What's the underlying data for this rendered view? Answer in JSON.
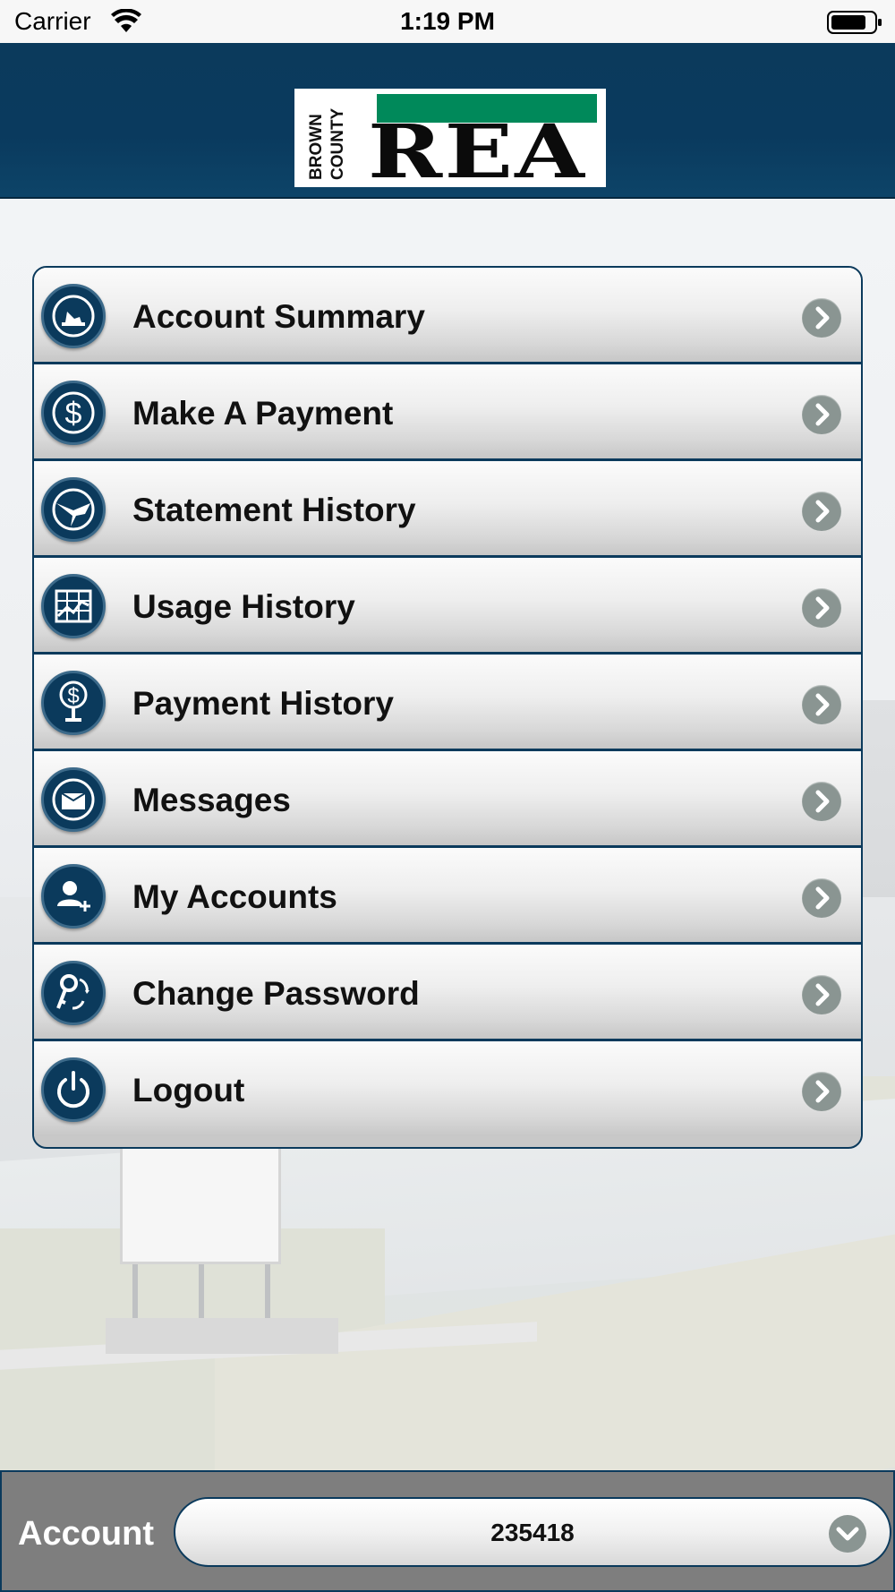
{
  "status_bar": {
    "carrier": "Carrier",
    "time": "1:19 PM",
    "wifi_icon": "wifi-icon",
    "battery_icon": "battery-icon"
  },
  "header": {
    "logo": {
      "vertical_text": "BROWN COUNTY",
      "main_text": "REA",
      "accent_color": "#00895a"
    },
    "background_color": "#0b3a5c"
  },
  "menu": {
    "items": [
      {
        "label": "Account Summary",
        "icon": "account-summary-icon"
      },
      {
        "label": "Make A Payment",
        "icon": "dollar-icon"
      },
      {
        "label": "Statement History",
        "icon": "statement-icon"
      },
      {
        "label": "Usage History",
        "icon": "usage-chart-icon"
      },
      {
        "label": "Payment History",
        "icon": "payment-history-icon"
      },
      {
        "label": "Messages",
        "icon": "envelope-icon"
      },
      {
        "label": "My Accounts",
        "icon": "add-user-icon"
      },
      {
        "label": "Change Password",
        "icon": "key-icon"
      },
      {
        "label": "Logout",
        "icon": "power-icon"
      }
    ],
    "chevron_icon": "chevron-right-icon",
    "border_color": "#0b3a5c"
  },
  "footer": {
    "label": "Account",
    "selected_account": "235418",
    "chevron_icon": "chevron-down-icon"
  }
}
